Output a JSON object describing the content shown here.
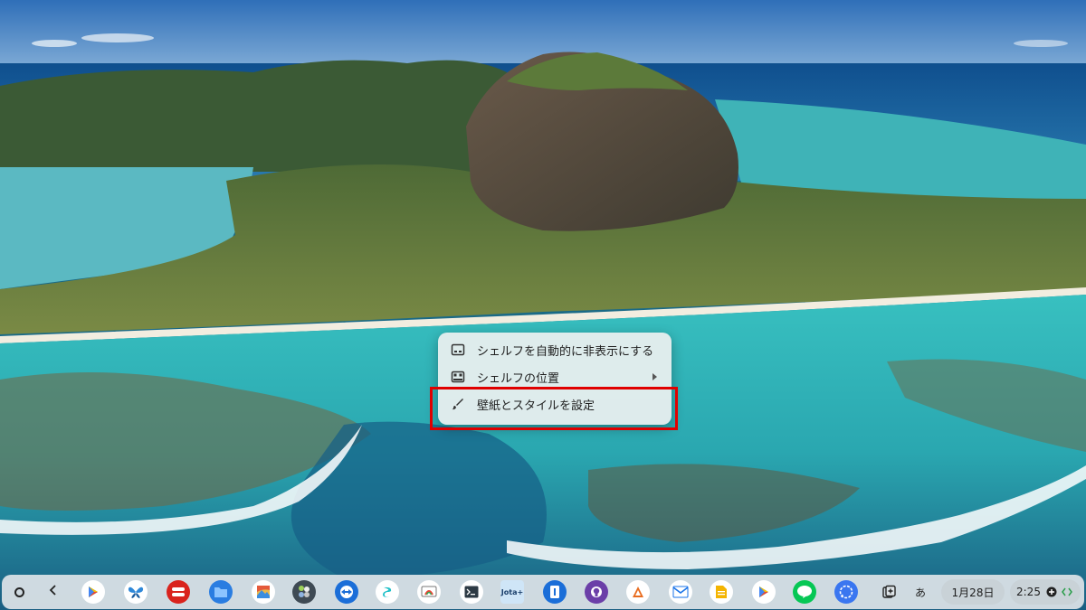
{
  "context_menu": {
    "items": [
      {
        "label": "シェルフを自動的に非表示にする",
        "icon": "autohide-icon"
      },
      {
        "label": "シェルフの位置",
        "icon": "shelf-position-icon",
        "has_submenu": true
      },
      {
        "label": "壁紙とスタイルを設定",
        "icon": "paintbrush-icon"
      }
    ],
    "highlight_color": "#e00000"
  },
  "shelf": {
    "apps": [
      {
        "name": "google-play",
        "icon": "google-play-icon"
      },
      {
        "name": "butterfly",
        "icon": "butterfly-icon"
      },
      {
        "name": "red-app",
        "icon": "red-app-icon"
      },
      {
        "name": "files",
        "icon": "folder-icon"
      },
      {
        "name": "gallery",
        "icon": "gallery-icon"
      },
      {
        "name": "multi-app",
        "icon": "multi-app-icon"
      },
      {
        "name": "teamviewer",
        "icon": "teamviewer-icon"
      },
      {
        "name": "surfshark",
        "icon": "surfshark-icon"
      },
      {
        "name": "chrome-remote",
        "icon": "chrome-remote-icon"
      },
      {
        "name": "terminal",
        "icon": "terminal-icon"
      },
      {
        "name": "jota-text-editor",
        "icon": "jota-icon",
        "label": "Jota+"
      },
      {
        "name": "blue-app",
        "icon": "blue-app-icon"
      },
      {
        "name": "github",
        "icon": "github-icon"
      },
      {
        "name": "office-app",
        "icon": "office-icon"
      },
      {
        "name": "mail-app",
        "icon": "mail-icon"
      },
      {
        "name": "docs-app",
        "icon": "docs-icon"
      },
      {
        "name": "play-store-2",
        "icon": "google-play-icon"
      },
      {
        "name": "line",
        "icon": "line-icon",
        "label": "LINE"
      },
      {
        "name": "signal",
        "icon": "signal-icon"
      }
    ],
    "tray": {
      "ime_label": "あ",
      "date": "1月28日",
      "time": "2:25"
    }
  },
  "colors": {
    "shelf_bg": "#dee4e8",
    "menu_bg": "#ecf0f0"
  }
}
